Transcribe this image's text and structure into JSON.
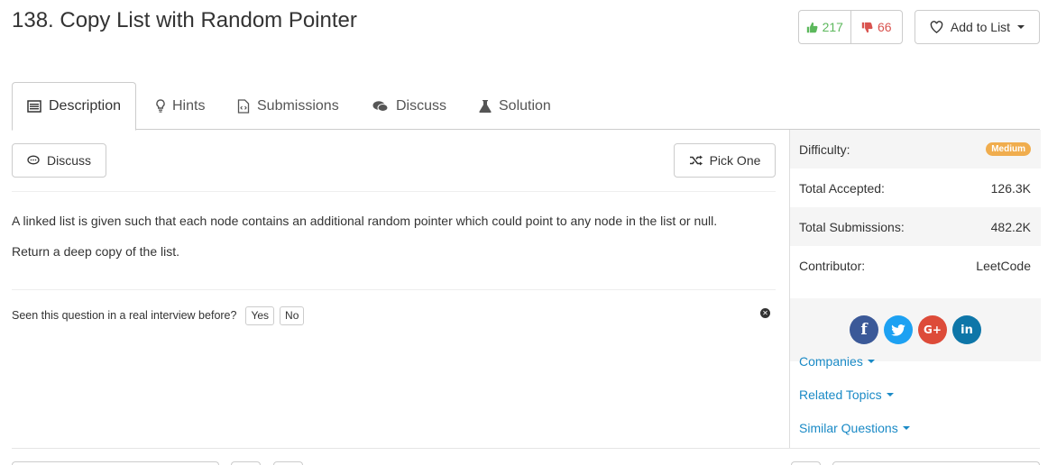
{
  "problem": {
    "title": "138. Copy List with Random Pointer"
  },
  "votes": {
    "up": "217",
    "down": "66"
  },
  "add_to_list": {
    "label": "Add to List"
  },
  "tabs": [
    {
      "label": "Description",
      "icon": "description-icon"
    },
    {
      "label": "Hints",
      "icon": "lightbulb-icon"
    },
    {
      "label": "Submissions",
      "icon": "code-file-icon"
    },
    {
      "label": "Discuss",
      "icon": "comments-icon"
    },
    {
      "label": "Solution",
      "icon": "flask-icon"
    }
  ],
  "actions": {
    "discuss": "Discuss",
    "pick_one": "Pick One"
  },
  "description": {
    "p1": "A linked list is given such that each node contains an additional random pointer which could point to any node in the list or null.",
    "p2": "Return a deep copy of the list."
  },
  "interview": {
    "question": "Seen this question in a real interview before?",
    "yes": "Yes",
    "no": "No"
  },
  "stats": {
    "difficulty_label": "Difficulty:",
    "difficulty": "Medium",
    "accepted_label": "Total Accepted:",
    "accepted": "126.3K",
    "submissions_label": "Total Submissions:",
    "submissions": "482.2K",
    "contributor_label": "Contributor:",
    "contributor": "LeetCode"
  },
  "social": [
    {
      "name": "facebook",
      "glyph": "f",
      "color": "#3b5998"
    },
    {
      "name": "twitter",
      "glyph": "🐦",
      "color": "#1da1f2"
    },
    {
      "name": "google-plus",
      "glyph": "G+",
      "color": "#dd4b39"
    },
    {
      "name": "linkedin",
      "glyph": "in",
      "color": "#0e76a8"
    }
  ],
  "dropdowns": {
    "companies": "Companies",
    "related_topics": "Related Topics",
    "similar_questions": "Similar Questions"
  },
  "colors": {
    "accent_link": "#1a8ac6",
    "upvote": "#5cb85c",
    "downvote": "#d9534f",
    "medium_badge": "#f0ad4e"
  }
}
